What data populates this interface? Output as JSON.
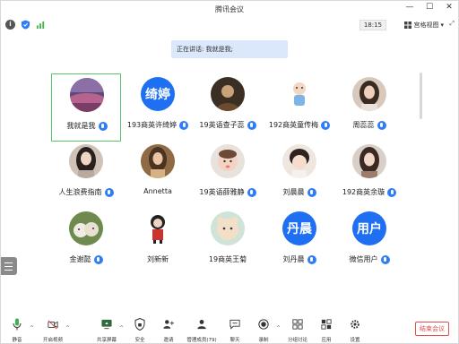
{
  "window": {
    "title": "腾讯会议"
  },
  "infobar": {
    "timer": "18:15",
    "view_label": "宫格视图"
  },
  "banner": {
    "text": "正在讲话: 我就是我;"
  },
  "participants": [
    {
      "name": "我就是我",
      "avatar": "photo-sunset",
      "text": ""
    },
    {
      "name": "193商英许绮婷",
      "avatar": "text",
      "text": "绮婷"
    },
    {
      "name": "19英语查子蕊",
      "avatar": "photo-man",
      "text": ""
    },
    {
      "name": "192商英童传梅",
      "avatar": "photo-cartoon",
      "text": ""
    },
    {
      "name": "周蕊蕊",
      "avatar": "photo-girl",
      "text": ""
    },
    {
      "name": "人生浪费指南",
      "avatar": "photo-woman",
      "text": ""
    },
    {
      "name": "Annetta",
      "avatar": "photo-woman2",
      "text": ""
    },
    {
      "name": "19英语薛雅静",
      "avatar": "photo-baby",
      "text": ""
    },
    {
      "name": "刘晨晨",
      "avatar": "photo-child",
      "text": ""
    },
    {
      "name": "192商英余璇",
      "avatar": "photo-girl2",
      "text": ""
    },
    {
      "name": "金谢懿",
      "avatar": "photo-dogs",
      "text": ""
    },
    {
      "name": "刘新新",
      "avatar": "photo-cartoon2",
      "text": ""
    },
    {
      "name": "19商英王菊",
      "avatar": "photo-plush",
      "text": ""
    },
    {
      "name": "刘丹晨",
      "avatar": "text",
      "text": "丹晨"
    },
    {
      "name": "微信用户",
      "avatar": "text",
      "text": "用户"
    }
  ],
  "toolbar": {
    "mute": "静音",
    "video": "开启视频",
    "share": "共享屏幕",
    "security": "安全",
    "invite": "邀请",
    "members": "管理成员(79)",
    "chat": "聊天",
    "record": "录制",
    "breakout": "分组讨论",
    "apps": "应用",
    "settings": "设置",
    "end": "结束会议"
  },
  "colors": {
    "accent": "#1f6ff2",
    "selected_border": "#5bc36a",
    "end": "#e05050"
  }
}
